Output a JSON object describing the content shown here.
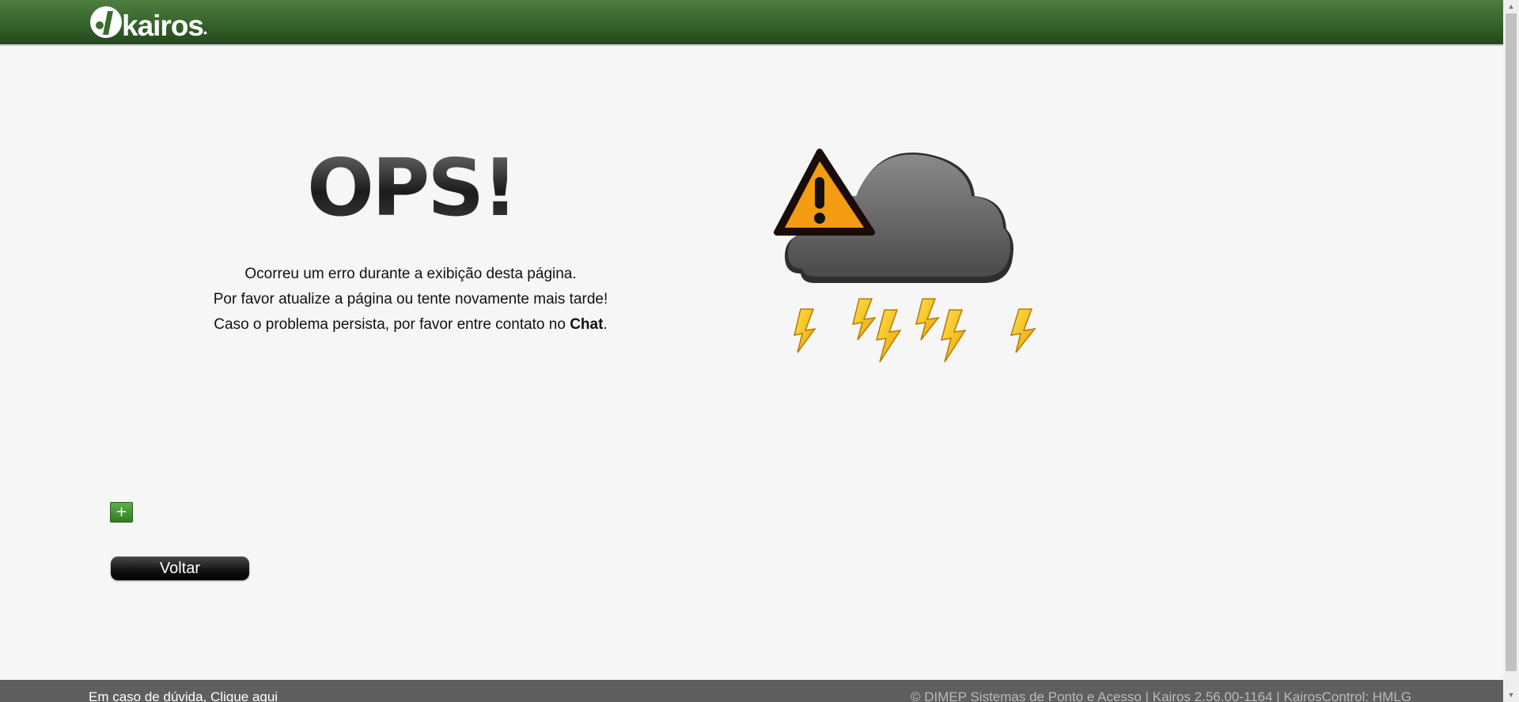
{
  "header": {
    "logo_text": "kairos"
  },
  "error": {
    "title": "OPS!",
    "line1": "Ocorreu um erro durante a exibição desta página.",
    "line2": "Por favor atualize a página ou tente novamente mais tarde!",
    "line3_prefix": "Caso o problema persista, por favor entre contato no ",
    "line3_link": "Chat",
    "line3_suffix": "."
  },
  "actions": {
    "expand_label": "+",
    "back_label": "Voltar"
  },
  "footer": {
    "help_link": "Em caso de dúvida, Clique aqui",
    "info": "© DIMEP Sistemas de Ponto e Acesso | Kairos 2.56.00-1164 | KairosControl: HMLG"
  },
  "colors": {
    "header_green": "#3f6b33",
    "footer_gray": "#5f5f5f",
    "background": "#f6f6f6",
    "warning_orange": "#f39c12",
    "bolt_yellow": "#f7c21a"
  },
  "icons": {
    "logo": "kairos-logo-icon",
    "illustration": "storm-cloud-warning-icon",
    "bolt": "lightning-bolt-icon"
  }
}
